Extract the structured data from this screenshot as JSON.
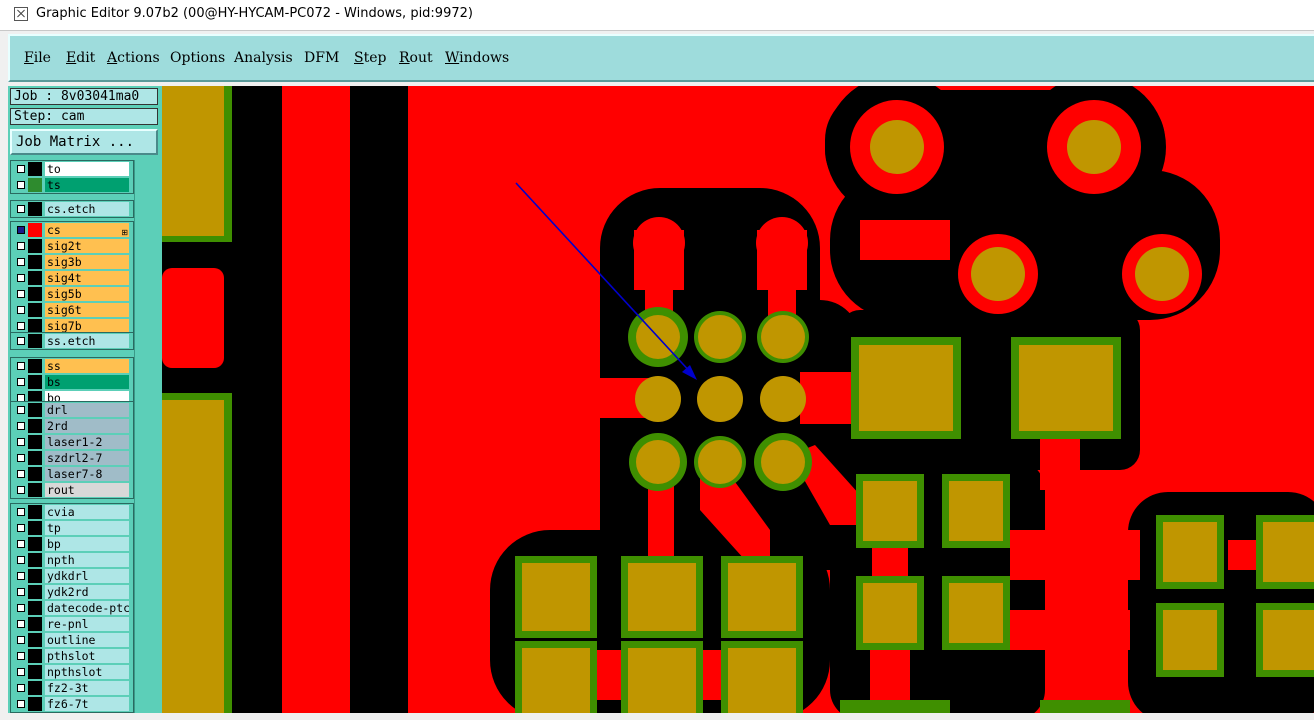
{
  "window": {
    "title": "Graphic Editor 9.07b2 (00@HY-HYCAM-PC072 - Windows, pid:9972)"
  },
  "menu": [
    {
      "label": "File",
      "underline": true
    },
    {
      "label": "Edit",
      "underline": true
    },
    {
      "label": "Actions",
      "underline": true
    },
    {
      "label": "Options",
      "underline": false
    },
    {
      "label": "Analysis",
      "underline": false
    },
    {
      "label": "DFM",
      "underline": false
    },
    {
      "label": "Step",
      "underline": true
    },
    {
      "label": "Rout",
      "underline": true
    },
    {
      "label": "Windows",
      "underline": true
    }
  ],
  "job": {
    "job_label": "Job : 8v03041ma0",
    "step_label": "Step: cam",
    "matrix_button": "Job Matrix ..."
  },
  "layers": [
    {
      "group": 0,
      "name": "to",
      "color": "#000000",
      "bg": "#ffffff",
      "checked": false
    },
    {
      "group": 0,
      "name": "ts",
      "color": "#2e8b2e",
      "bg": "#00a070",
      "checked": false
    },
    {
      "group": 1,
      "name": "cs.etch",
      "color": "#000000",
      "bg": "#aee6e6",
      "checked": false
    },
    {
      "group": 2,
      "name": "cs",
      "color": "#ff0000",
      "bg": "#ffc050",
      "checked": true,
      "expand": "⊞"
    },
    {
      "group": 2,
      "name": "sig2t",
      "color": "#000000",
      "bg": "#ffc050",
      "checked": false
    },
    {
      "group": 2,
      "name": "sig3b",
      "color": "#000000",
      "bg": "#ffc050",
      "checked": false
    },
    {
      "group": 2,
      "name": "sig4t",
      "color": "#000000",
      "bg": "#ffc050",
      "checked": false
    },
    {
      "group": 2,
      "name": "sig5b",
      "color": "#000000",
      "bg": "#ffc050",
      "checked": false
    },
    {
      "group": 2,
      "name": "sig6t",
      "color": "#000000",
      "bg": "#ffc050",
      "checked": false
    },
    {
      "group": 2,
      "name": "sig7b",
      "color": "#000000",
      "bg": "#ffc050",
      "checked": false
    },
    {
      "group": 3,
      "name": "ss.etch",
      "color": "#000000",
      "bg": "#aee6e6",
      "checked": false
    },
    {
      "group": 4,
      "name": "ss",
      "color": "#000000",
      "bg": "#ffc050",
      "checked": false
    },
    {
      "group": 4,
      "name": "bs",
      "color": "#000000",
      "bg": "#00a070",
      "checked": false
    },
    {
      "group": 4,
      "name": "bo",
      "color": "#000000",
      "bg": "#ffffff",
      "checked": false
    },
    {
      "group": 5,
      "name": "drl",
      "color": "#000000",
      "bg": "#a0bcc8",
      "checked": false
    },
    {
      "group": 5,
      "name": "2rd",
      "color": "#000000",
      "bg": "#a0bcc8",
      "checked": false
    },
    {
      "group": 5,
      "name": "laser1-2",
      "color": "#000000",
      "bg": "#a0bcc8",
      "checked": false
    },
    {
      "group": 5,
      "name": "szdrl2-7",
      "color": "#000000",
      "bg": "#a0bcc8",
      "checked": false
    },
    {
      "group": 5,
      "name": "laser7-8",
      "color": "#000000",
      "bg": "#a0bcc8",
      "checked": false
    },
    {
      "group": 5,
      "name": "rout",
      "color": "#000000",
      "bg": "#d8d8d8",
      "checked": false
    },
    {
      "group": 6,
      "name": "cvia",
      "color": "#000000",
      "bg": "#aee6e6",
      "checked": false
    },
    {
      "group": 6,
      "name": "tp",
      "color": "#000000",
      "bg": "#aee6e6",
      "checked": false
    },
    {
      "group": 6,
      "name": "bp",
      "color": "#000000",
      "bg": "#aee6e6",
      "checked": false
    },
    {
      "group": 6,
      "name": "npth",
      "color": "#000000",
      "bg": "#aee6e6",
      "checked": false
    },
    {
      "group": 6,
      "name": "ydkdrl",
      "color": "#000000",
      "bg": "#aee6e6",
      "checked": false
    },
    {
      "group": 6,
      "name": "ydk2rd",
      "color": "#000000",
      "bg": "#aee6e6",
      "checked": false
    },
    {
      "group": 6,
      "name": "datecode-ptc",
      "color": "#000000",
      "bg": "#aee6e6",
      "checked": false
    },
    {
      "group": 6,
      "name": "re-pnl",
      "color": "#000000",
      "bg": "#aee6e6",
      "checked": false
    },
    {
      "group": 6,
      "name": "outline",
      "color": "#000000",
      "bg": "#aee6e6",
      "checked": false
    },
    {
      "group": 6,
      "name": "pthslot",
      "color": "#000000",
      "bg": "#aee6e6",
      "checked": false
    },
    {
      "group": 6,
      "name": "npthslot",
      "color": "#000000",
      "bg": "#aee6e6",
      "checked": false
    },
    {
      "group": 6,
      "name": "fz2-3t",
      "color": "#000000",
      "bg": "#aee6e6",
      "checked": false
    },
    {
      "group": 6,
      "name": "fz6-7t",
      "color": "#000000",
      "bg": "#aee6e6",
      "checked": false
    }
  ],
  "colors": {
    "copper": "#ff0000",
    "clearance": "#000000",
    "pad_fill": "#c09600",
    "pad_ring": "#3f8f00",
    "annotation_arrow": "#0000cc",
    "menubar": "#9edcdc",
    "panel": "#5ccfb8"
  }
}
